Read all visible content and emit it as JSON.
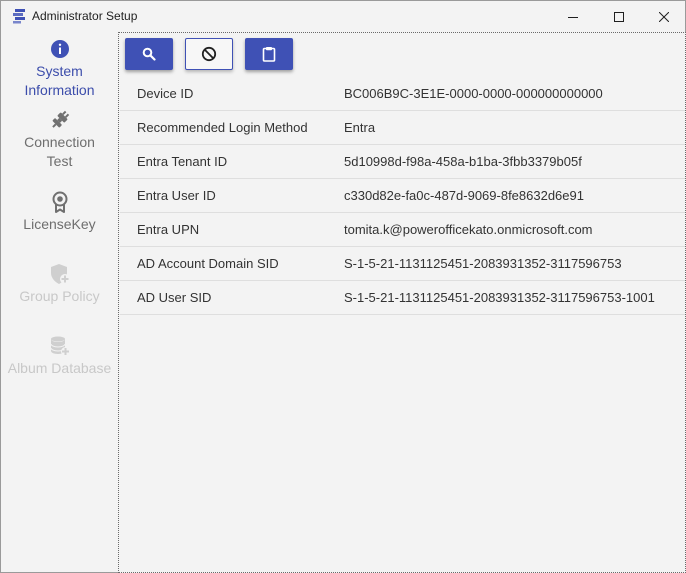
{
  "window": {
    "title": "Administrator Setup",
    "accent_color": "#3f51b5"
  },
  "sidebar": {
    "items": [
      {
        "label_line1": "System",
        "label_line2": "Information",
        "icon": "info-icon",
        "state": "active"
      },
      {
        "label_line1": "Connection",
        "label_line2": "Test",
        "icon": "plug-icon",
        "state": "normal"
      },
      {
        "label_line1": "LicenseKey",
        "label_line2": "",
        "icon": "badge-icon",
        "state": "normal"
      },
      {
        "label_line1": "Group Policy",
        "label_line2": "",
        "icon": "shield-add-icon",
        "state": "disabled"
      },
      {
        "label_line1": "Album Database",
        "label_line2": "",
        "icon": "database-add-icon",
        "state": "disabled"
      }
    ]
  },
  "toolbar": {
    "buttons": [
      {
        "icon": "search-icon",
        "style": "primary"
      },
      {
        "icon": "block-icon",
        "style": "outline"
      },
      {
        "icon": "clipboard-icon",
        "style": "primary"
      }
    ]
  },
  "info": {
    "rows": [
      {
        "label": "Device ID",
        "value": "BC006B9C-3E1E-0000-0000-000000000000"
      },
      {
        "label": "Recommended Login Method",
        "value": "Entra"
      },
      {
        "label": "Entra Tenant ID",
        "value": "5d10998d-f98a-458a-b1ba-3fbb3379b05f"
      },
      {
        "label": "Entra User ID",
        "value": "c330d82e-fa0c-487d-9069-8fe8632d6e91"
      },
      {
        "label": "Entra UPN",
        "value": "tomita.k@powerofficekato.onmicrosoft.com"
      },
      {
        "label": "AD Account Domain SID",
        "value": "S-1-5-21-1131125451-2083931352-3117596753"
      },
      {
        "label": "AD User SID",
        "value": "S-1-5-21-1131125451-2083931352-3117596753-1001"
      }
    ]
  }
}
